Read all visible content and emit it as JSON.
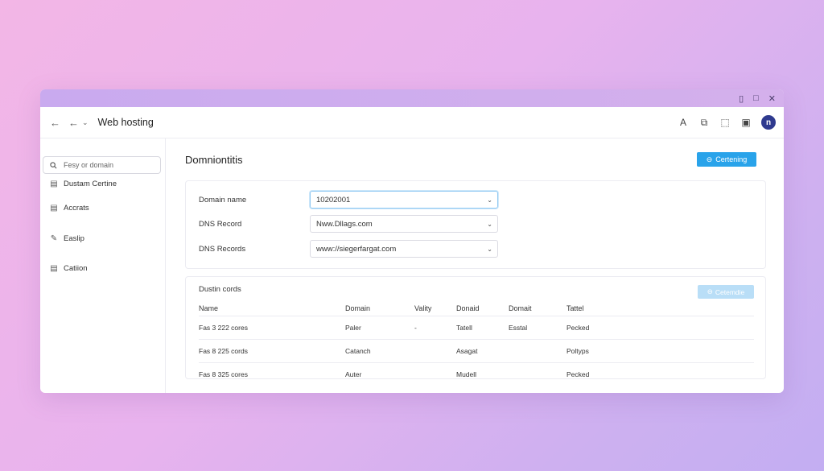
{
  "window": {
    "controls": [
      "▯",
      "□",
      "✕"
    ]
  },
  "toolbar": {
    "title": "Web hosting",
    "back_glyph": "←",
    "back2_glyph": "←",
    "chevron_glyph": "⌄",
    "right_icons": [
      "A",
      "⧉",
      "⬚",
      "▣"
    ],
    "avatar_letter": "n"
  },
  "sidebar": {
    "search_placeholder": "Fesy or domain",
    "items": [
      {
        "icon": "▤",
        "label": "Dustam Certine"
      },
      {
        "icon": "▤",
        "label": "Accrats"
      },
      {
        "icon": "✎",
        "label": "Easlip"
      },
      {
        "icon": "▤",
        "label": "Catiion"
      }
    ]
  },
  "main": {
    "title": "Domniontitis",
    "primary_button": {
      "icon": "⊖",
      "label": "Certening"
    },
    "form": {
      "rows": [
        {
          "label": "Domain name",
          "value": "10202001"
        },
        {
          "label": "DNS Record",
          "value": "Nww.Dllags.com"
        },
        {
          "label": "DNS Records",
          "value": "www://siegerfargat.com"
        }
      ]
    },
    "records": {
      "title": "Dustin cords",
      "button": {
        "icon": "⊖",
        "label": "Cetemdie"
      },
      "columns": [
        "Name",
        "Domain",
        "Vality",
        "Donaid",
        "Domait",
        "Tattel"
      ],
      "rows": [
        [
          "Fas 3 222 cores",
          "Paler",
          "-",
          "Tatell",
          "Esstal",
          "Pecked"
        ],
        [
          "Fas 8 225 cords",
          "Catanch",
          "",
          "Asagat",
          "",
          "Poltyps"
        ],
        [
          "Fas 8 325 cores",
          "Auter",
          "",
          "Mudell",
          "",
          "Pecked"
        ]
      ]
    }
  },
  "colors": {
    "accent": "#29a3ea",
    "accent_light": "#b9def7",
    "titlebar": "#c9aaef",
    "avatar": "#2f3a8f"
  }
}
